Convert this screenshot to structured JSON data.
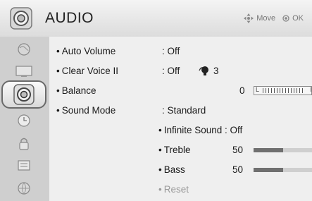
{
  "header": {
    "title": "AUDIO",
    "move_label": "Move",
    "ok_label": "OK",
    "header_icon": "speaker-icon"
  },
  "sidebar": {
    "items": [
      {
        "icon": "picture-globe-icon"
      },
      {
        "icon": "tv-screen-icon"
      },
      {
        "icon": "audio-speaker-icon",
        "active": true
      },
      {
        "icon": "clock-icon"
      },
      {
        "icon": "lock-icon"
      },
      {
        "icon": "option-icon"
      },
      {
        "icon": "network-icon"
      }
    ]
  },
  "menu": {
    "auto_volume": {
      "label": "Auto Volume",
      "value": ": Off"
    },
    "clear_voice": {
      "label": "Clear Voice II",
      "value": ": Off",
      "level": "3"
    },
    "balance": {
      "label": "Balance",
      "value": "0",
      "left_mark": "L",
      "right_mark": "R"
    },
    "sound_mode": {
      "label": "Sound Mode",
      "value": ": Standard"
    },
    "infinite_sound": {
      "label": "Infinite Sound : Off"
    },
    "treble": {
      "label": "Treble",
      "value": "50",
      "level_fraction": 0.5
    },
    "bass": {
      "label": "Bass",
      "value": "50",
      "level_fraction": 0.5
    },
    "reset": {
      "label": "Reset",
      "enabled": false
    }
  },
  "colors": {
    "bar_fill": "#6f6f6f",
    "bar_track": "#cfcfcf",
    "disabled_text": "#9a9a9a"
  }
}
